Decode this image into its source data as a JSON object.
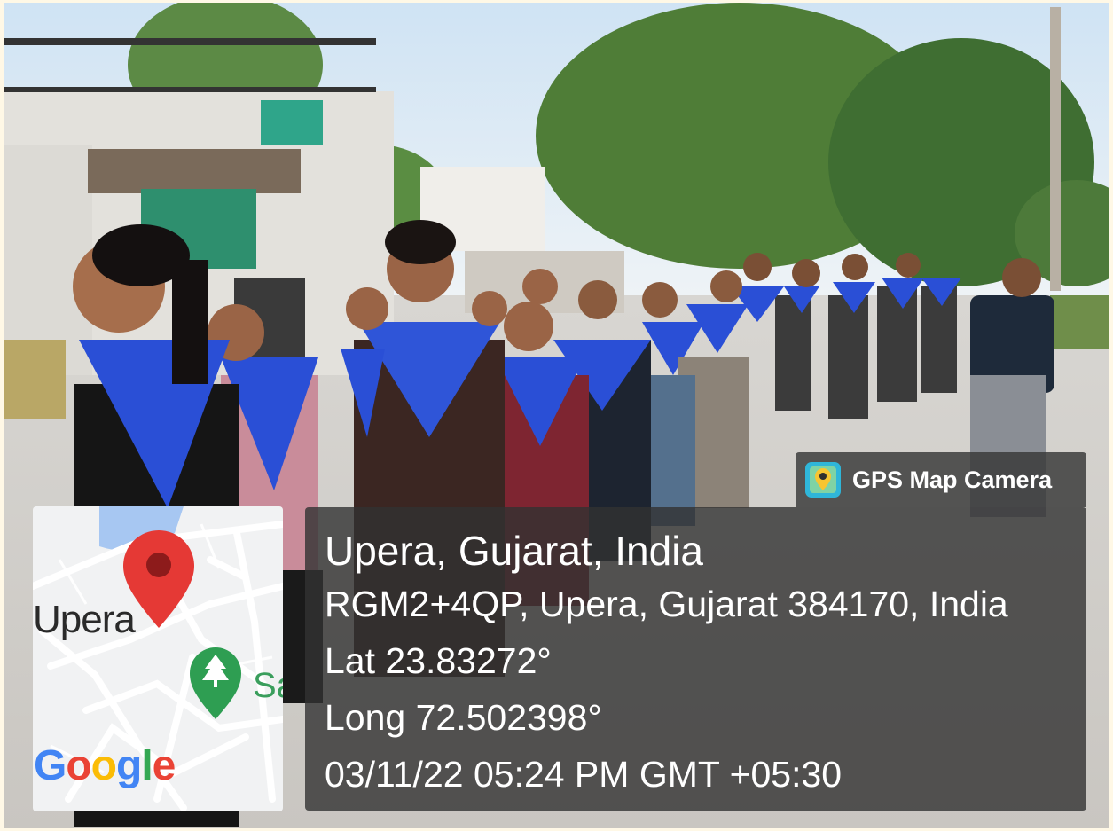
{
  "stamp": {
    "app_label": "GPS Map Camera",
    "city": "Upera, Gujarat, India",
    "address": "RGM2+4QP, Upera, Gujarat 384170, India",
    "lat": "Lat 23.83272°",
    "long": "Long 72.502398°",
    "datetime": "03/11/22 05:24 PM GMT +05:30"
  },
  "map": {
    "place_label": "Upera",
    "secondary_label": "Sa",
    "logo": {
      "g1": "G",
      "g2": "o",
      "g3": "o",
      "g4": "g",
      "g5": "l",
      "g6": "e"
    }
  },
  "colors": {
    "scarf_blue": "#2a4fd6",
    "panel": "#323232",
    "map_pin": "#e53935",
    "map_park": "#2e9e52"
  }
}
